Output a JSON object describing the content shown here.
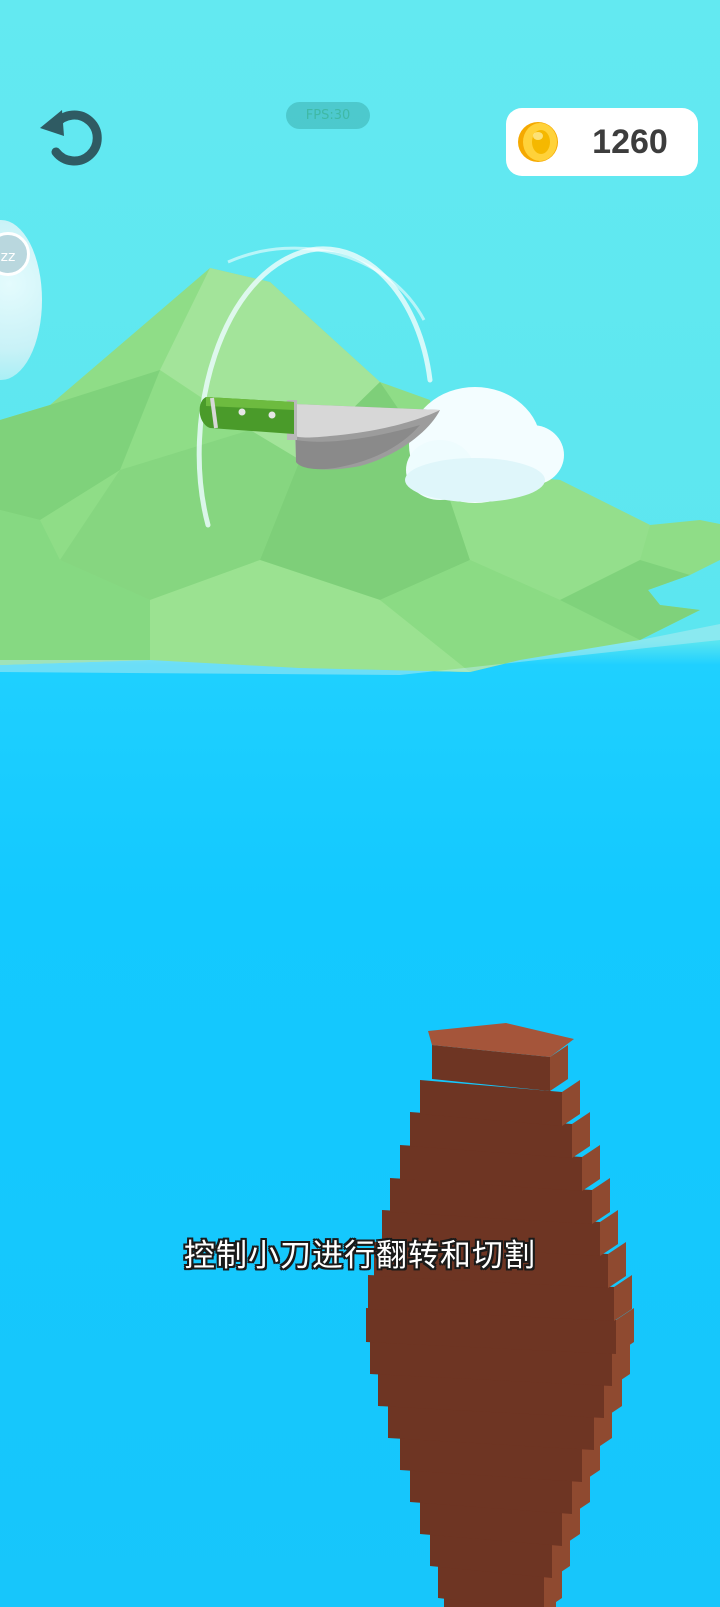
{
  "hud": {
    "restart_icon": "restart-arrow-icon",
    "level_label": "FPS:30",
    "coins": "1260",
    "coin_icon": "gold-coin-icon",
    "sleep_badge": "zz"
  },
  "subtitle": "控制小刀进行翻转和切割",
  "colors": {
    "sky": "#63e9f1",
    "water": "#13c9ff",
    "island": "#8fdd87",
    "knife_handle": "#4a9b2a",
    "wood": "#a5553a"
  }
}
